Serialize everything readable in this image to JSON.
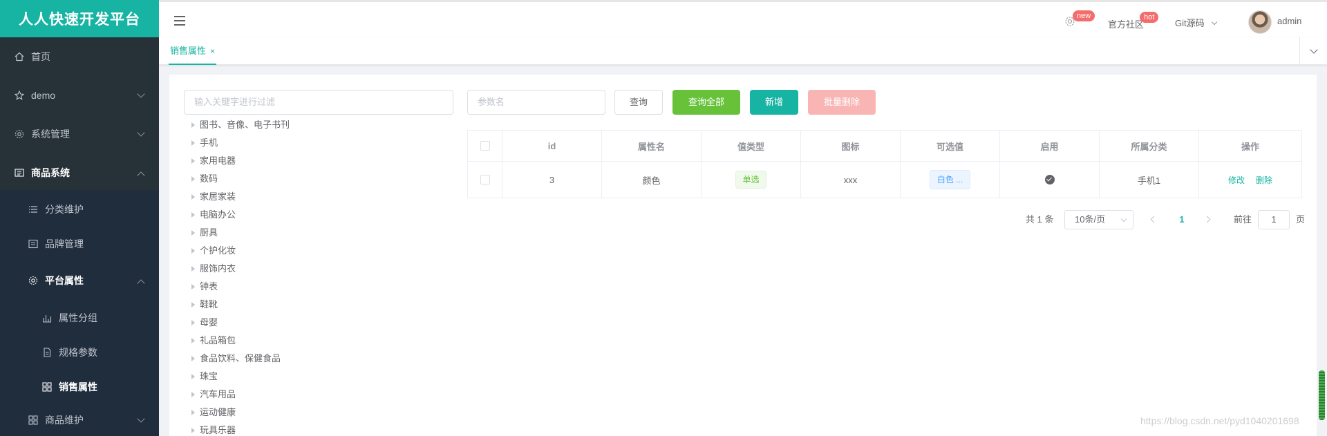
{
  "brand": "人人快速开发平台",
  "sidebar": {
    "items": [
      {
        "label": "首页",
        "icon": "home-icon"
      },
      {
        "label": "demo",
        "icon": "star-icon"
      },
      {
        "label": "系统管理",
        "icon": "gear-icon"
      },
      {
        "label": "商品系统",
        "icon": "computer-icon"
      },
      {
        "label": "分类维护",
        "icon": "list-icon"
      },
      {
        "label": "品牌管理",
        "icon": "brand-icon"
      },
      {
        "label": "平台属性",
        "icon": "gear-icon"
      },
      {
        "label": "属性分组",
        "icon": "bar-chart-icon"
      },
      {
        "label": "规格参数",
        "icon": "document-icon"
      },
      {
        "label": "销售属性",
        "icon": "grid-icon"
      },
      {
        "label": "商品维护",
        "icon": "grid-icon"
      }
    ]
  },
  "header": {
    "new_badge": "new",
    "community": "官方社区",
    "hot_badge": "hot",
    "git": "Git源码",
    "user": "admin"
  },
  "tabs": [
    {
      "label": "销售属性",
      "close": "×"
    }
  ],
  "filter": {
    "placeholder": "输入关键字进行过滤"
  },
  "tree": [
    "图书、音像、电子书刊",
    "手机",
    "家用电器",
    "数码",
    "家居家装",
    "电脑办公",
    "厨具",
    "个护化妆",
    "服饰内衣",
    "钟表",
    "鞋靴",
    "母婴",
    "礼品箱包",
    "食品饮料、保健食品",
    "珠宝",
    "汽车用品",
    "运动健康",
    "玩具乐器"
  ],
  "toolbar": {
    "param_placeholder": "参数名",
    "query": "查询",
    "query_all": "查询全部",
    "add": "新增",
    "batch_delete": "批量删除"
  },
  "table": {
    "headers": [
      "id",
      "属性名",
      "值类型",
      "图标",
      "可选值",
      "启用",
      "所属分类",
      "操作"
    ],
    "rows": [
      {
        "id": "3",
        "name": "颜色",
        "value_type": "单选",
        "icon": "xxx",
        "options": "白色 ...",
        "enabled": true,
        "category": "手机1",
        "edit": "修改",
        "delete": "删除"
      }
    ]
  },
  "pagination": {
    "total": "共 1 条",
    "page_size": "10条/页",
    "current": "1",
    "goto_prefix": "前往",
    "goto_value": "1",
    "goto_suffix": "页"
  },
  "watermark": "https://blog.csdn.net/pyd1040201698",
  "colors": {
    "accent": "#17b3a3",
    "sidebar": "#263238",
    "success": "#67c23a",
    "danger_light": "#f9b4b4"
  }
}
